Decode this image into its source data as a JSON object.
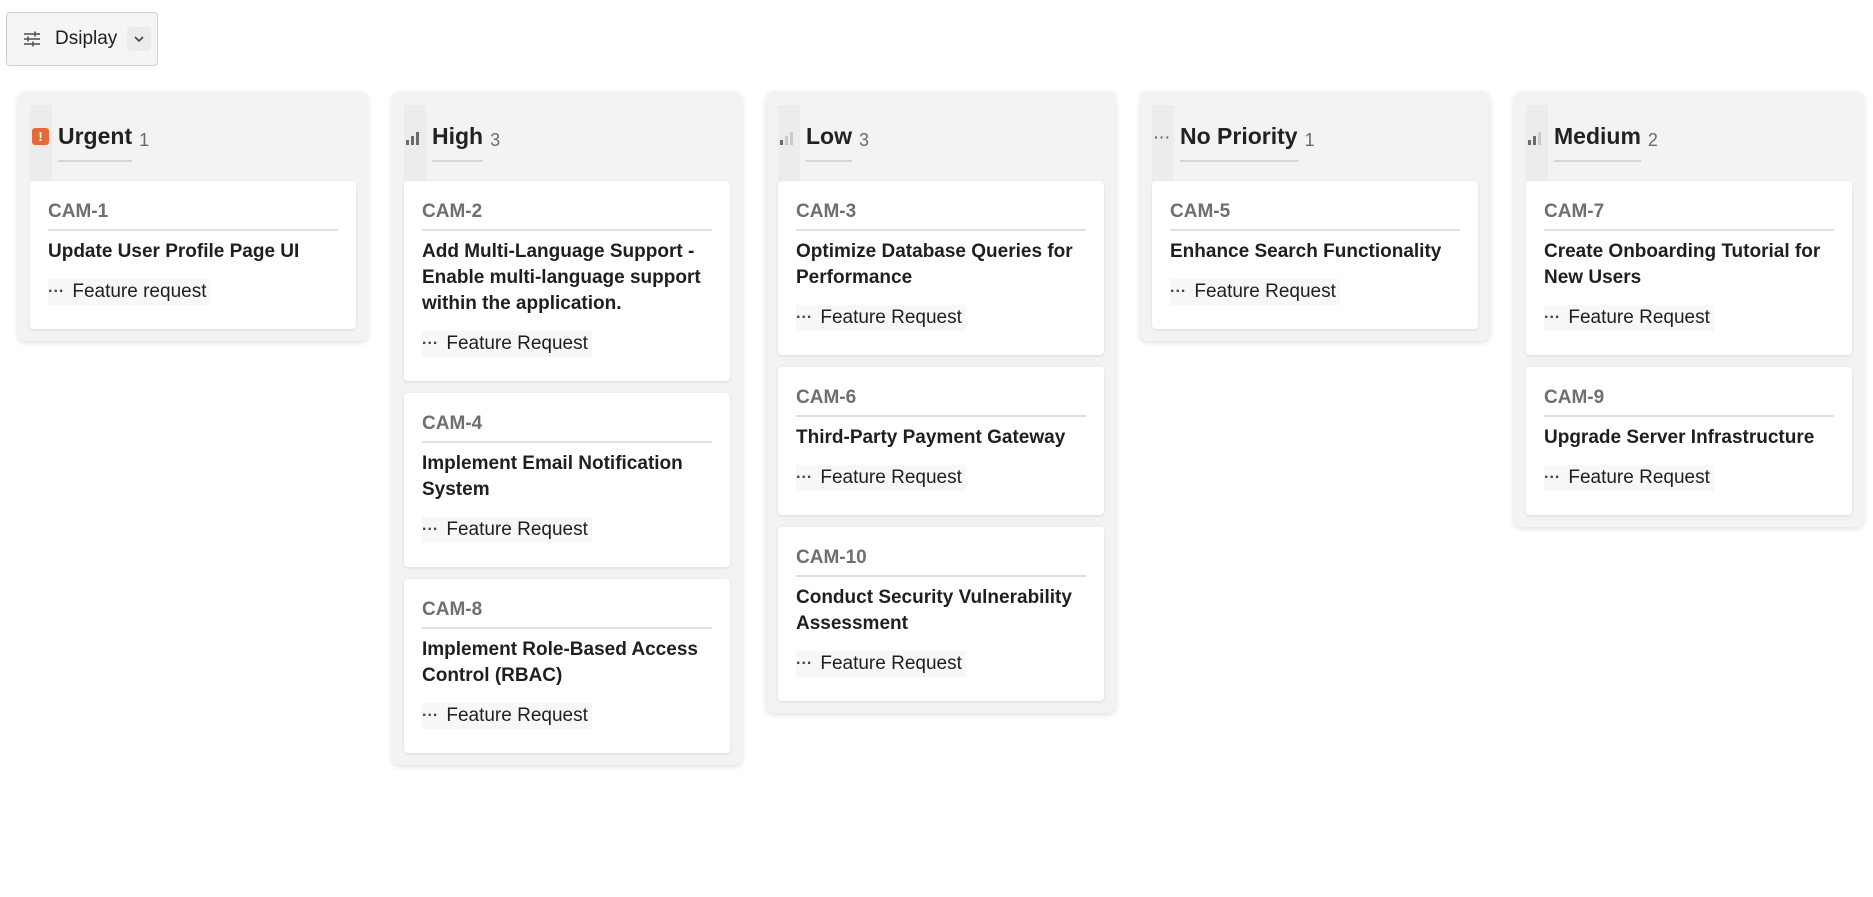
{
  "toolbar": {
    "display_label": "Dsiplay",
    "display_icon": "sliders-icon",
    "chevron_icon": "chevron-down-icon"
  },
  "colors": {
    "urgent": "#e8683a",
    "bar_active": "#6b6b6b",
    "bar_inactive": "#c9c9c9",
    "column_bg": "#f3f3f3",
    "card_bg": "#ffffff"
  },
  "columns": [
    {
      "title": "Urgent",
      "count": "1",
      "icon": "urgent-icon",
      "cards": [
        {
          "id": "CAM-1",
          "title": "Update User Profile Page UI",
          "tag": "Feature request"
        }
      ]
    },
    {
      "title": "High",
      "count": "3",
      "icon": "priority-high-icon",
      "cards": [
        {
          "id": "CAM-2",
          "title": "Add Multi-Language Support - Enable multi-language support within the application.",
          "tag": "Feature Request"
        },
        {
          "id": "CAM-4",
          "title": "Implement Email Notification System",
          "tag": "Feature Request"
        },
        {
          "id": "CAM-8",
          "title": "Implement Role-Based Access Control (RBAC)",
          "tag": "Feature Request"
        }
      ]
    },
    {
      "title": "Low",
      "count": "3",
      "icon": "priority-low-icon",
      "cards": [
        {
          "id": "CAM-3",
          "title": "Optimize Database Queries for Performance",
          "tag": "Feature Request"
        },
        {
          "id": "CAM-6",
          "title": "Third-Party Payment Gateway",
          "tag": "Feature Request"
        },
        {
          "id": "CAM-10",
          "title": "Conduct Security Vulnerability Assessment",
          "tag": "Feature Request"
        }
      ]
    },
    {
      "title": "No Priority",
      "count": "1",
      "icon": "no-priority-icon",
      "cards": [
        {
          "id": "CAM-5",
          "title": "Enhance Search Functionality",
          "tag": "Feature Request"
        }
      ]
    },
    {
      "title": "Medium",
      "count": "2",
      "icon": "priority-medium-icon",
      "cards": [
        {
          "id": "CAM-7",
          "title": "Create Onboarding Tutorial for New Users",
          "tag": "Feature Request"
        },
        {
          "id": "CAM-9",
          "title": "Upgrade Server Infrastructure",
          "tag": "Feature Request"
        }
      ]
    }
  ]
}
